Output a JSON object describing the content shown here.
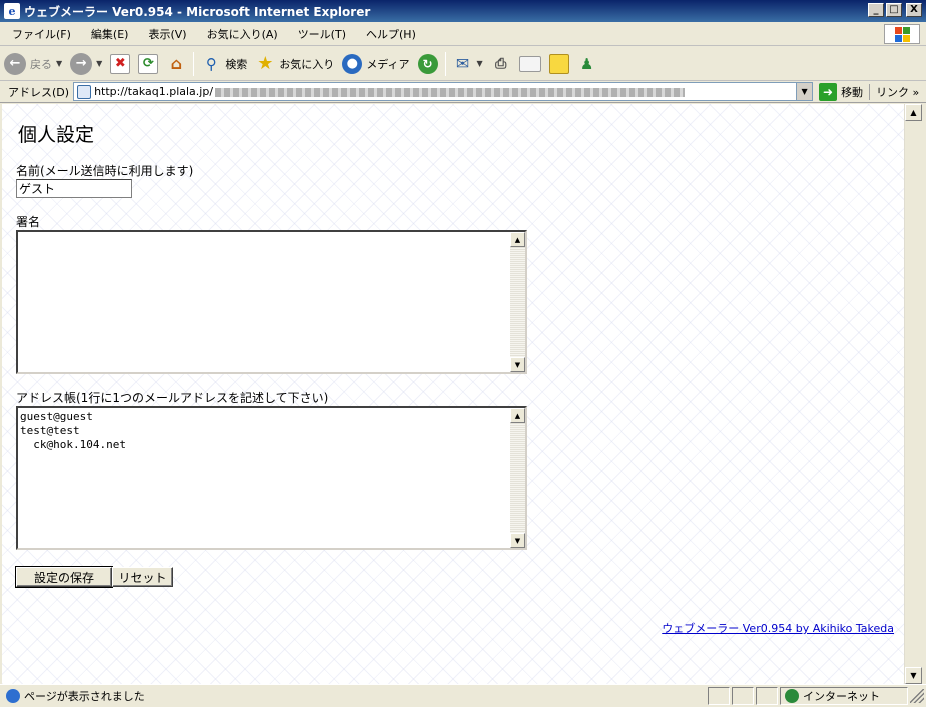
{
  "window": {
    "title": "ウェブメーラー  Ver0.954 - Microsoft Internet Explorer",
    "controls": {
      "minimize": "_",
      "maximize": "□",
      "close": "X"
    }
  },
  "menu": [
    "ファイル(F)",
    "編集(E)",
    "表示(V)",
    "お気に入り(A)",
    "ツール(T)",
    "ヘルプ(H)"
  ],
  "toolbar": {
    "back": "戻る",
    "search": "検索",
    "favorites": "お気に入り",
    "media": "メディア"
  },
  "address": {
    "label": "アドレス(D)",
    "url": "http://takaq1.plala.jp/",
    "go": "移動",
    "links": "リンク »"
  },
  "page": {
    "title": "個人設定",
    "name_label": "名前(メール送信時に利用します)",
    "name_value": "ゲスト",
    "signature_label": "署名",
    "signature_value": "",
    "addressbook_label": "アドレス帳(1行に1つのメールアドレスを記述して下さい)",
    "addressbook_value": "guest@guest\ntest@test\n  ck@hok.104.net",
    "save_button": "設定の保存",
    "reset_button": "リセット",
    "footer_link": "ウェブメーラー  Ver0.954  by  Akihiko  Takeda"
  },
  "status": {
    "text": "ページが表示されました",
    "zone": "インターネット"
  },
  "icons": {
    "app": "ie-icon",
    "back": "back-arrow-icon",
    "forward": "forward-arrow-icon",
    "stop": "stop-icon",
    "refresh": "refresh-icon",
    "home": "home-icon",
    "search": "search-icon",
    "favorites": "star-icon",
    "media": "media-globe-icon",
    "history": "history-icon",
    "mail": "mail-icon",
    "print": "printer-icon",
    "edit": "edit-icon",
    "discuss": "discuss-icon",
    "messenger": "messenger-icon"
  }
}
